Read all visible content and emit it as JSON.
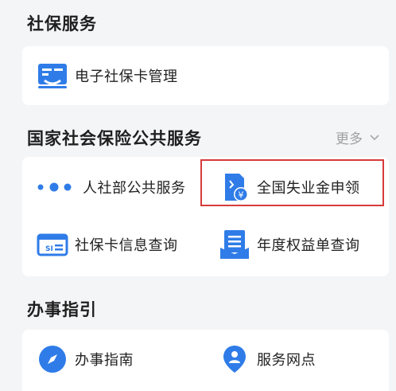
{
  "social_security": {
    "title": "社保服务",
    "items": [
      {
        "label": "电子社保卡管理",
        "icon": "e-card-icon"
      }
    ]
  },
  "public_services": {
    "title": "国家社会保险公共服务",
    "more_label": "更多",
    "items": [
      {
        "label": "人社部公共服务",
        "icon": "dots-icon"
      },
      {
        "label": "全国失业金申领",
        "icon": "unemployment-benefit-icon"
      },
      {
        "label": "社保卡信息查询",
        "icon": "si-card-icon"
      },
      {
        "label": "年度权益单查询",
        "icon": "annual-statement-icon"
      }
    ]
  },
  "guide": {
    "title": "办事指引",
    "items": [
      {
        "label": "办事指南",
        "icon": "compass-icon"
      },
      {
        "label": "服务网点",
        "icon": "location-pin-icon"
      }
    ]
  },
  "colors": {
    "accent_blue": "#2f7ce8",
    "highlight_red": "#d83a3a",
    "background": "#f4f5f7"
  }
}
